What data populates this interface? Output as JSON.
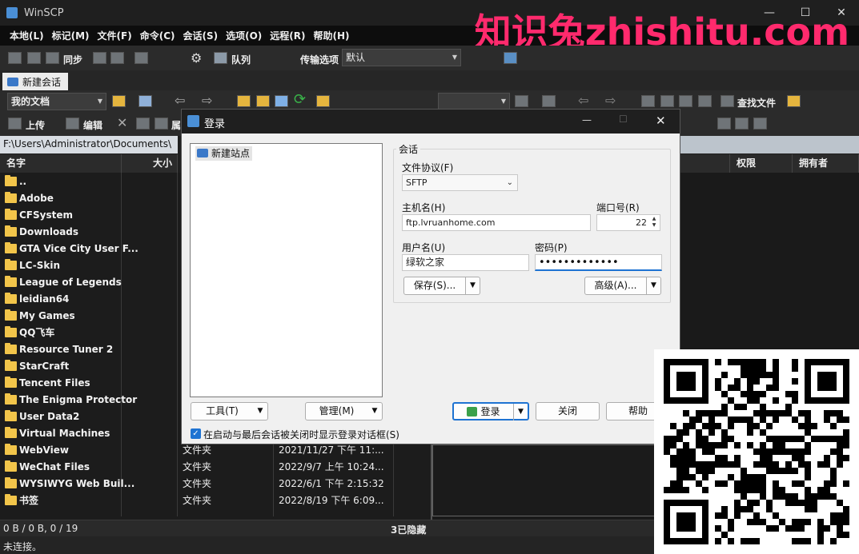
{
  "window": {
    "title": "WinSCP"
  },
  "watermark": "知识兔zhishitu.com",
  "menu": [
    "本地(L)",
    "标记(M)",
    "文件(F)",
    "命令(C)",
    "会话(S)",
    "选项(O)",
    "远程(R)",
    "帮助(H)"
  ],
  "toolbar": {
    "sync_label": "同步",
    "queue_label": "队列",
    "transfer_label": "传输选项",
    "transfer_value": "默认"
  },
  "tab": {
    "label": "新建会话"
  },
  "local_toolbar": {
    "folder_label": "我的文档",
    "upload_label": "上传",
    "edit_label": "编辑",
    "props_label": "属"
  },
  "remote_toolbar": {
    "find_label": "查找文件"
  },
  "local_path": "F:\\Users\\Administrator\\Documents\\",
  "local_columns": {
    "name": "名字",
    "size": "大小"
  },
  "remote_columns": {
    "perm": "权限",
    "owner": "拥有者"
  },
  "files": [
    {
      "name": ".."
    },
    {
      "name": "Adobe"
    },
    {
      "name": "CFSystem"
    },
    {
      "name": "Downloads"
    },
    {
      "name": "GTA Vice City User F..."
    },
    {
      "name": "LC-Skin"
    },
    {
      "name": "League of Legends"
    },
    {
      "name": "leidian64"
    },
    {
      "name": "My Games"
    },
    {
      "name": "QQ飞车"
    },
    {
      "name": "Resource Tuner 2"
    },
    {
      "name": "StarCraft"
    },
    {
      "name": "Tencent Files"
    },
    {
      "name": "The Enigma Protector"
    },
    {
      "name": "User Data2"
    },
    {
      "name": "Virtual Machines"
    },
    {
      "name": "WebView",
      "type": "文件夹",
      "date": "2021/11/27 下午 11:..."
    },
    {
      "name": "WeChat Files",
      "type": "文件夹",
      "date": "2022/9/7 上午 10:24..."
    },
    {
      "name": "WYSIWYG Web Buil...",
      "type": "文件夹",
      "date": "2022/6/1 下午 2:15:32"
    },
    {
      "name": "书签",
      "type": "文件夹",
      "date": "2022/8/19 下午 6:09..."
    }
  ],
  "status": {
    "selection": "0 B / 0 B,  0 / 19",
    "hidden": "3已隐藏",
    "connection": "未连接。"
  },
  "login": {
    "title": "登录",
    "site": "新建站点",
    "group_label": "会话",
    "protocol_label": "文件协议(F)",
    "protocol_value": "SFTP",
    "host_label": "主机名(H)",
    "host_value": "ftp.lvruanhome.com",
    "port_label": "端口号(R)",
    "port_value": "22",
    "user_label": "用户名(U)",
    "user_value": "绿软之家",
    "password_label": "密码(P)",
    "password_value": "•••••••••••••",
    "save_label": "保存(S)...",
    "advanced_label": "高级(A)...",
    "tools_label": "工具(T)",
    "manage_label": "管理(M)",
    "login_label": "登录",
    "close_label": "关闭",
    "help_label": "帮助",
    "startup_label": "在启动与最后会话被关闭时显示登录对话框(S)"
  },
  "colors": {
    "accent": "#1e73d2",
    "watermark": "#ff2a6d"
  }
}
